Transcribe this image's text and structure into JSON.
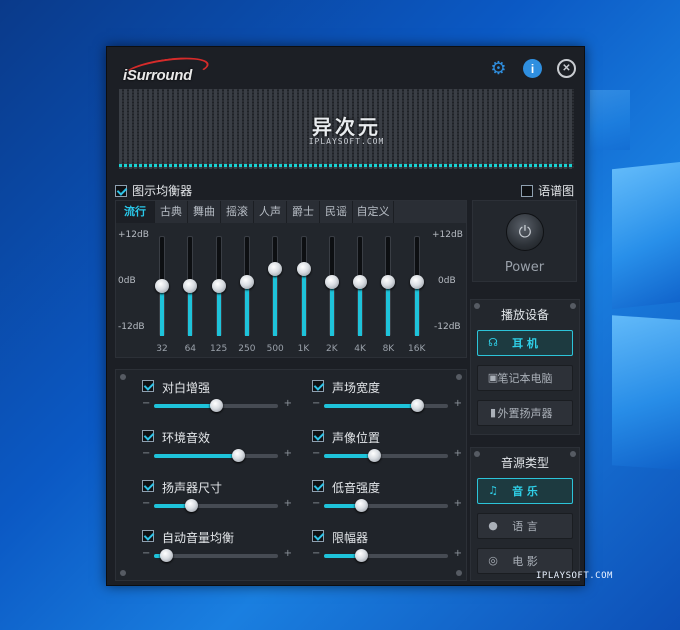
{
  "app": {
    "logo": "iSurround"
  },
  "watermark": "IPLAYSOFT.COM",
  "spectrum": {
    "title": "异次元",
    "subtitle": "IPLAYSOFT.COM"
  },
  "eq": {
    "toggle_label": "图示均衡器",
    "enabled": true,
    "spectrum_toggle_label": "语谱图",
    "spectrum_enabled": false,
    "tabs": [
      "流行",
      "古典",
      "舞曲",
      "摇滚",
      "人声",
      "爵士",
      "民谣",
      "自定义"
    ],
    "active_tab": "流行",
    "db_top": "+12dB",
    "db_mid": "0dB",
    "db_bot": "-12dB",
    "bands": [
      {
        "freq": "32",
        "gain_db": 0
      },
      {
        "freq": "64",
        "gain_db": 0
      },
      {
        "freq": "125",
        "gain_db": 0
      },
      {
        "freq": "250",
        "gain_db": 1
      },
      {
        "freq": "500",
        "gain_db": 4
      },
      {
        "freq": "1K",
        "gain_db": 4
      },
      {
        "freq": "2K",
        "gain_db": 1
      },
      {
        "freq": "4K",
        "gain_db": 1
      },
      {
        "freq": "8K",
        "gain_db": 1
      },
      {
        "freq": "16K",
        "gain_db": 1
      }
    ]
  },
  "power": {
    "label": "Power"
  },
  "playback": {
    "title": "播放设备",
    "devices": [
      {
        "label": "耳 机",
        "icon": "headphones-icon",
        "active": true
      },
      {
        "label": "笔记本电脑",
        "icon": "laptop-icon",
        "active": false
      },
      {
        "label": "外置扬声器",
        "icon": "speaker-icon",
        "active": false
      }
    ]
  },
  "source": {
    "title": "音源类型",
    "types": [
      {
        "label": "音 乐",
        "icon": "music-note-icon",
        "active": true
      },
      {
        "label": "语 言",
        "icon": "speech-icon",
        "active": false
      },
      {
        "label": "电 影",
        "icon": "film-icon",
        "active": false
      }
    ]
  },
  "effects": {
    "minus": "−",
    "plus": "+",
    "items": [
      {
        "label": "对白增强",
        "checked": true,
        "value": 0.5
      },
      {
        "label": "声场宽度",
        "checked": true,
        "value": 0.75
      },
      {
        "label": "环境音效",
        "checked": true,
        "value": 0.68
      },
      {
        "label": "声像位置",
        "checked": true,
        "value": 0.4
      },
      {
        "label": "扬声器尺寸",
        "checked": true,
        "value": 0.3
      },
      {
        "label": "低音强度",
        "checked": true,
        "value": 0.3
      },
      {
        "label": "自动音量均衡",
        "checked": true,
        "value": 0.1
      },
      {
        "label": "限幅器",
        "checked": true,
        "value": 0.3
      }
    ]
  },
  "colors": {
    "accent": "#1ec3da",
    "logo_red": "#e0302f",
    "icon_blue": "#2f8fe0"
  }
}
